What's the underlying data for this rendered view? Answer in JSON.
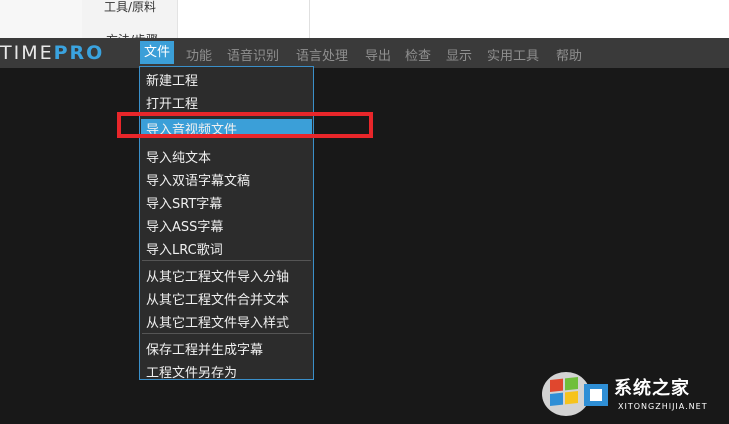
{
  "background_page": {
    "left_item": "工具/原料",
    "left_item_2": "方法/步骤"
  },
  "app": {
    "logo_prefix": "TIME",
    "logo_suffix": "PRO"
  },
  "menubar": {
    "items": [
      {
        "label": "文件",
        "active": true
      },
      {
        "label": "功能"
      },
      {
        "label": "语音识别"
      },
      {
        "label": "语言处理"
      },
      {
        "label": "导出"
      },
      {
        "label": "检查"
      },
      {
        "label": "显示"
      },
      {
        "label": "实用工具"
      },
      {
        "label": "帮助"
      }
    ]
  },
  "file_menu": {
    "groups": [
      [
        "新建工程",
        "打开工程"
      ],
      [
        "导入音视频文件",
        "导入纯文本",
        "导入双语字幕文稿",
        "导入SRT字幕",
        "导入ASS字幕",
        "导入LRC歌词"
      ],
      [
        "从其它工程文件导入分轴",
        "从其它工程文件合并文本",
        "从其它工程文件导入样式"
      ],
      [
        "保存工程并生成字幕",
        "工程文件另存为"
      ]
    ],
    "highlighted_item": "导入音视频文件"
  },
  "watermark": {
    "title": "系统之家",
    "subtitle": "XITONGZHIJIA.NET"
  },
  "colors": {
    "accent": "#3b9fd8",
    "annotation_red": "#e8262a",
    "menubar_bg": "#3a3a3a",
    "canvas_bg": "#181818"
  }
}
